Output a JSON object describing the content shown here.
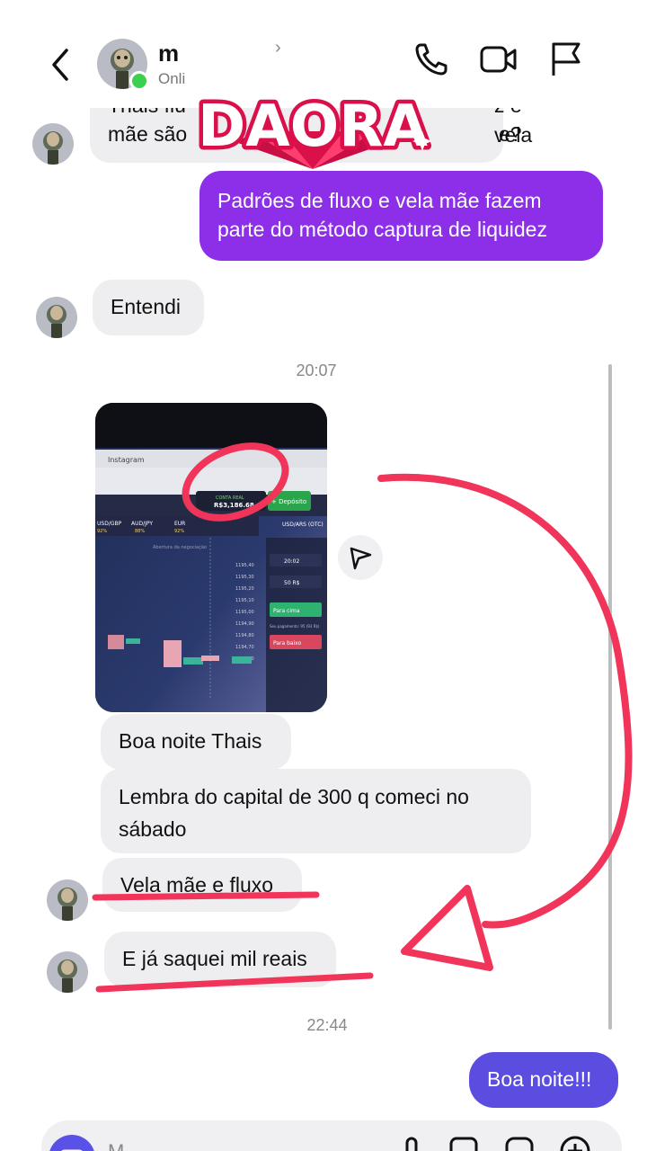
{
  "header": {
    "name": "m",
    "status": "Onli",
    "chevron": "›"
  },
  "sticker": {
    "text": "DAORA"
  },
  "messages": {
    "m1_line1": "Thais flu",
    "m1_line1b": "z e vela",
    "m1_line2": "mãe são",
    "m1_line2b": "e?",
    "m2_line1": "Padrões de fluxo e vela mãe fazem",
    "m2_line2": "parte do método captura de liquidez",
    "m3": "Entendi",
    "time1": "20:07",
    "m4": "Boa noite Thais",
    "m5_line1": "Lembra do capital de 300 q comeci no",
    "m5_line2": "sábado",
    "m6": "Vela mãe e fluxo",
    "m7": "E já saquei mil reais",
    "time2": "22:44",
    "m8": "Boa noite!!!"
  },
  "photo": {
    "tab_label": "Instagram",
    "balance_label": "CONTA REAL",
    "balance": "R$3,186.68",
    "deposit": "+ Depósito",
    "pair": "USD/ARS (OTC)",
    "asset1": "USD/GBP",
    "asset2": "AUD/JPY",
    "asset3": "EUR",
    "pct1": "92%",
    "pct2": "88%",
    "pct3": "92%",
    "open_label": "Abertura da negociação",
    "time_val": "20:02",
    "amount_val": "50 R$",
    "up_btn": "Para cima",
    "down_btn": "Para baixo",
    "payout": "Seu pagamento: 95 (93 R$)",
    "prices": [
      "1195,40",
      "1195,30",
      "1195,20",
      "1195,10",
      "1195,00",
      "1194,90",
      "1194,80",
      "1194,70",
      "1194,60"
    ]
  },
  "composer": {
    "placeholder": "M"
  },
  "colors": {
    "outgoing_purple": "#8d2fe8",
    "outgoing_blue": "#5b4de0",
    "incoming_gray": "#eeeef0",
    "annotation_red": "#f0345a",
    "online_green": "#3bd14f"
  },
  "icons": [
    "back-arrow-icon",
    "phone-icon",
    "video-camera-icon",
    "flag-icon",
    "send-icon",
    "camera-icon",
    "microphone-icon",
    "image-icon",
    "sticker-icon",
    "plus-icon"
  ]
}
